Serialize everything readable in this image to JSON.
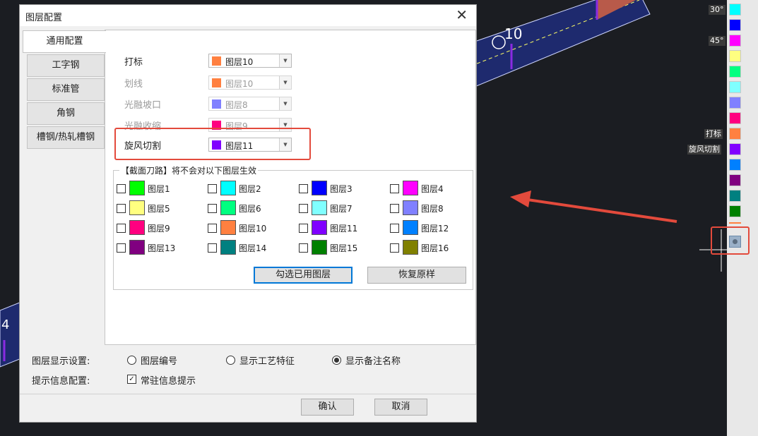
{
  "cad": {
    "label_10": "10",
    "label_4": "4",
    "angle_30": "30°",
    "angle_45": "45°",
    "side_label_mark": "打标",
    "side_label_cut": "旋风切割",
    "palette_colors": [
      "#00ffff",
      "#0000ff",
      "#ff00ff",
      "#ffff80",
      "#00ff80",
      "#80ffff",
      "#8080ff",
      "#ff0080",
      "#ff8040",
      "#8000ff",
      "#0080ff",
      "#800080",
      "#008080",
      "#008000"
    ]
  },
  "dialog": {
    "title": "图层配置",
    "tabs": [
      "通用配置",
      "工字钢",
      "标准管",
      "角钢",
      "槽钢/热轧槽钢"
    ],
    "rows": [
      {
        "label": "打标",
        "layer": "图层10",
        "color": "#ff8040",
        "disabled": false
      },
      {
        "label": "划线",
        "layer": "图层10",
        "color": "#ff8040",
        "disabled": true
      },
      {
        "label": "光融坡口",
        "layer": "图层8",
        "color": "#8080ff",
        "disabled": true
      },
      {
        "label": "光融收缩",
        "layer": "图层9",
        "color": "#ff0080",
        "disabled": true
      },
      {
        "label": "旋风切割",
        "layer": "图层11",
        "color": "#8000ff",
        "disabled": false
      }
    ],
    "group_title": "【截面刀路】将不会对以下图层生效",
    "layers": [
      {
        "name": "图层1",
        "color": "#00ff00"
      },
      {
        "name": "图层2",
        "color": "#00ffff"
      },
      {
        "name": "图层3",
        "color": "#0000ff"
      },
      {
        "name": "图层4",
        "color": "#ff00ff"
      },
      {
        "name": "图层5",
        "color": "#ffff80"
      },
      {
        "name": "图层6",
        "color": "#00ff80"
      },
      {
        "name": "图层7",
        "color": "#80ffff"
      },
      {
        "name": "图层8",
        "color": "#8080ff"
      },
      {
        "name": "图层9",
        "color": "#ff0080"
      },
      {
        "name": "图层10",
        "color": "#ff8040"
      },
      {
        "name": "图层11",
        "color": "#8000ff"
      },
      {
        "name": "图层12",
        "color": "#0080ff"
      },
      {
        "name": "图层13",
        "color": "#800080"
      },
      {
        "name": "图层14",
        "color": "#008080"
      },
      {
        "name": "图层15",
        "color": "#008000"
      },
      {
        "name": "图层16",
        "color": "#808000"
      }
    ],
    "select_used_button": "勾选已用图层",
    "restore_button": "恢复原样",
    "display_label": "图层显示设置:",
    "display_options": [
      "图层编号",
      "显示工艺特征",
      "显示备注名称"
    ],
    "display_selected": 2,
    "tip_label": "提示信息配置:",
    "tip_option": "常驻信息提示",
    "tip_checked": true,
    "ok_button": "确认",
    "cancel_button": "取消"
  },
  "accent_red": "#e34a3c"
}
